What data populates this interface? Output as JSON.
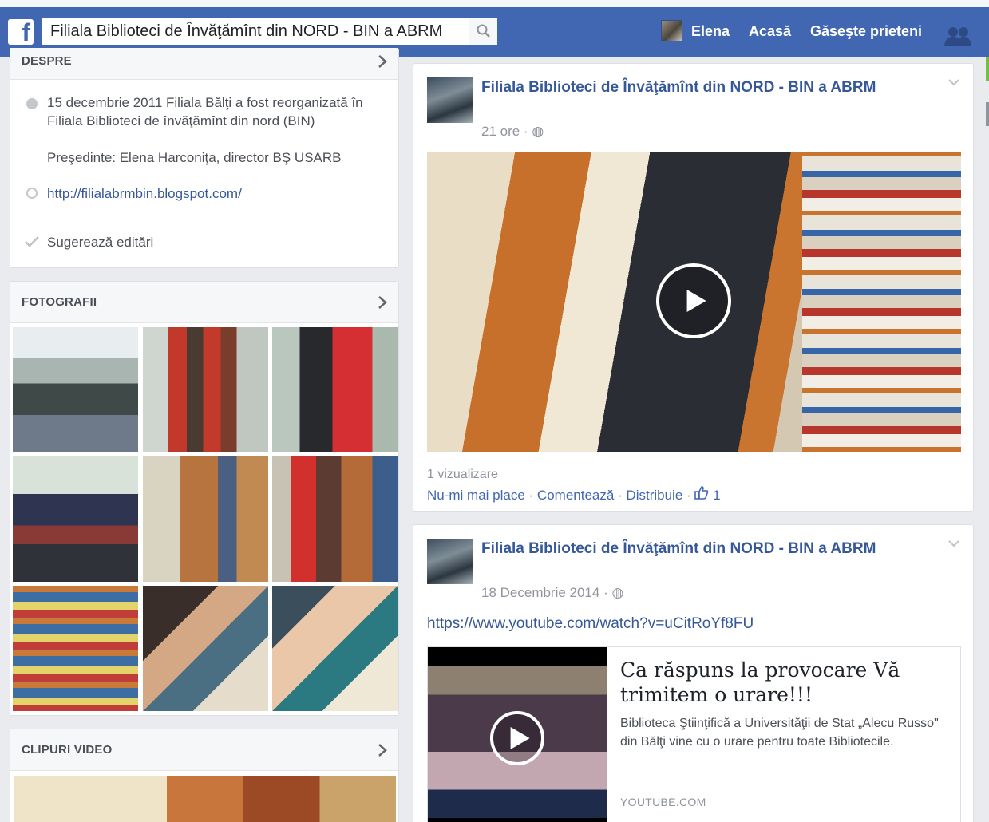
{
  "topbar": {
    "search_value": "Filiala Biblioteci de Învăţămînt din NORD - BIN a ABRM",
    "user_name": "Elena",
    "home_label": "Acasă",
    "find_friends_label": "Găseşte prieteni",
    "logo_letter": "f",
    "brand_color": "#4267b2"
  },
  "about": {
    "title": "DESPRE",
    "history": "15 decembrie 2011 Filiala Bălţi a fost reorganizată în Filiala Biblioteci de învăţămînt din nord (BIN)",
    "president": "Preşedinte: Elena Harconiţa, director BŞ USARB",
    "website": "http://filialabrmbin.blogspot.com/",
    "suggest_edits": "Sugerează editări"
  },
  "photos": {
    "title": "FOTOGRAFII",
    "items": [
      "photo-1",
      "photo-2",
      "photo-3",
      "photo-4",
      "photo-5",
      "photo-6",
      "photo-7",
      "photo-8",
      "photo-9"
    ]
  },
  "videos": {
    "title": "CLIPURI VIDEO"
  },
  "posts": [
    {
      "author": "Filiala Biblioteci de Învăţămînt din NORD - BIN a ABRM",
      "time": "21 ore",
      "views": "1 vizualizare",
      "unlike": "Nu-mi mai place",
      "comment": "Comentează",
      "share": "Distribuie",
      "likes": "1"
    },
    {
      "author": "Filiala Biblioteci de Învăţămînt din NORD - BIN a ABRM",
      "time": "18 Decembrie 2014",
      "link": "https://www.youtube.com/watch?v=uCitRoYf8FU",
      "card_title": "Ca răspuns la provocare Vă trimitem o urare!!!",
      "card_desc": "Biblioteca Ştiinţifică a Universităţii de Stat „Alecu Russo\" din Bălţi vine cu o urare pentru toate Bibliotecile.",
      "card_source": "YOUTUBE.COM"
    }
  ]
}
